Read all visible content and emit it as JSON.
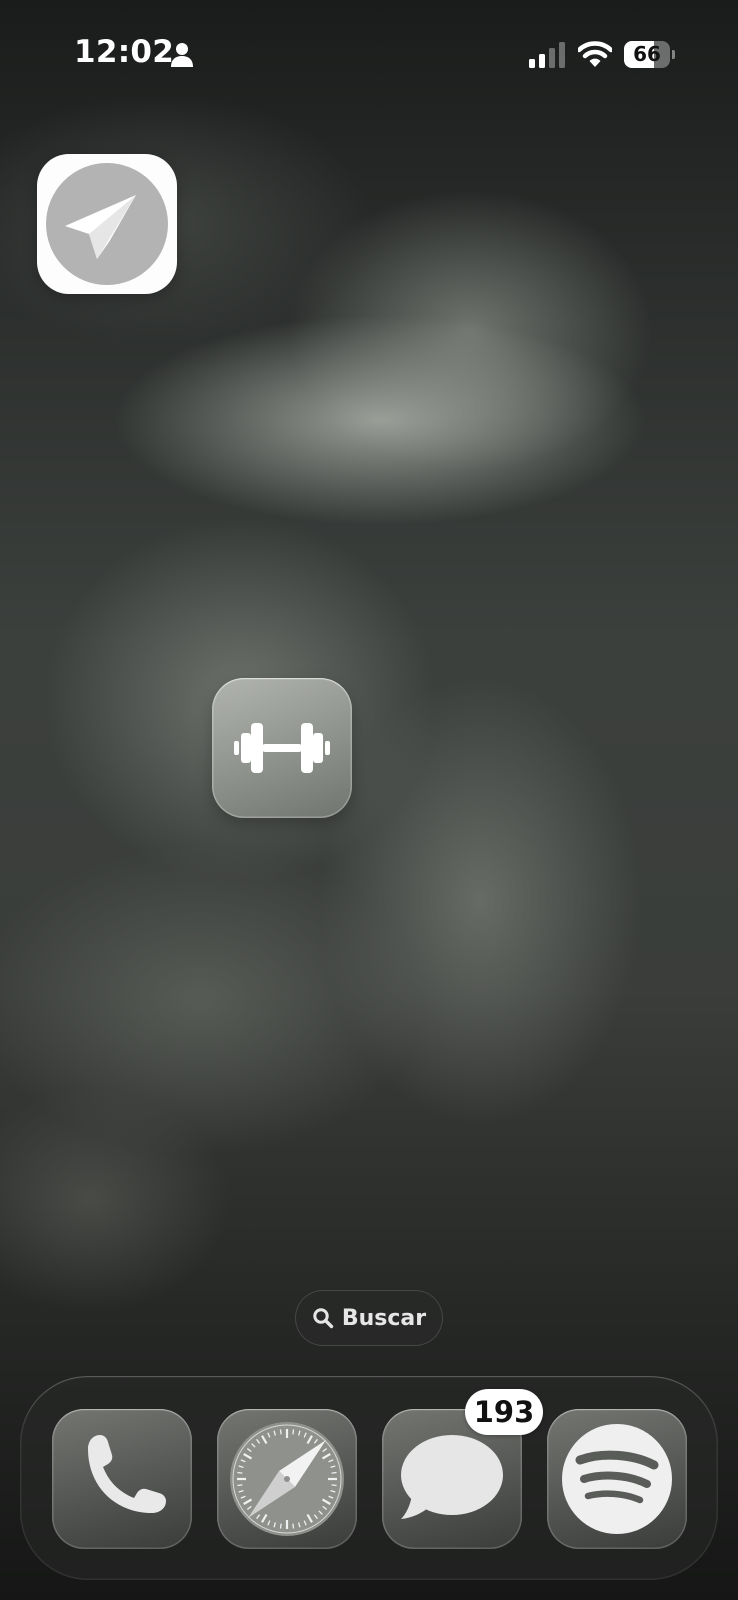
{
  "status_bar": {
    "time": "12:02",
    "battery_percent": "66",
    "battery_level": 0.66,
    "signal_bars_active": 2,
    "signal_bars_total": 4,
    "icons": [
      "person-icon",
      "cellular-signal-icon",
      "wifi-icon",
      "battery-icon"
    ]
  },
  "home_apps": [
    {
      "name": "Telegram",
      "icon": "telegram-paper-plane-icon"
    },
    {
      "name": "Fitness",
      "icon": "dumbbell-icon"
    }
  ],
  "search": {
    "label": "Buscar",
    "icon": "search-icon"
  },
  "dock": {
    "apps": [
      {
        "name": "Phone",
        "icon": "phone-icon"
      },
      {
        "name": "Safari",
        "icon": "compass-icon"
      },
      {
        "name": "Messages",
        "icon": "message-bubble-icon",
        "badge": "193"
      },
      {
        "name": "Spotify",
        "icon": "spotify-icon"
      }
    ]
  },
  "colors": {
    "badge_background": "#ffffff",
    "icon_glyph": "#ffffff",
    "telegram_tile": "#fdfdfd",
    "telegram_circle": "#b3b3b3"
  }
}
